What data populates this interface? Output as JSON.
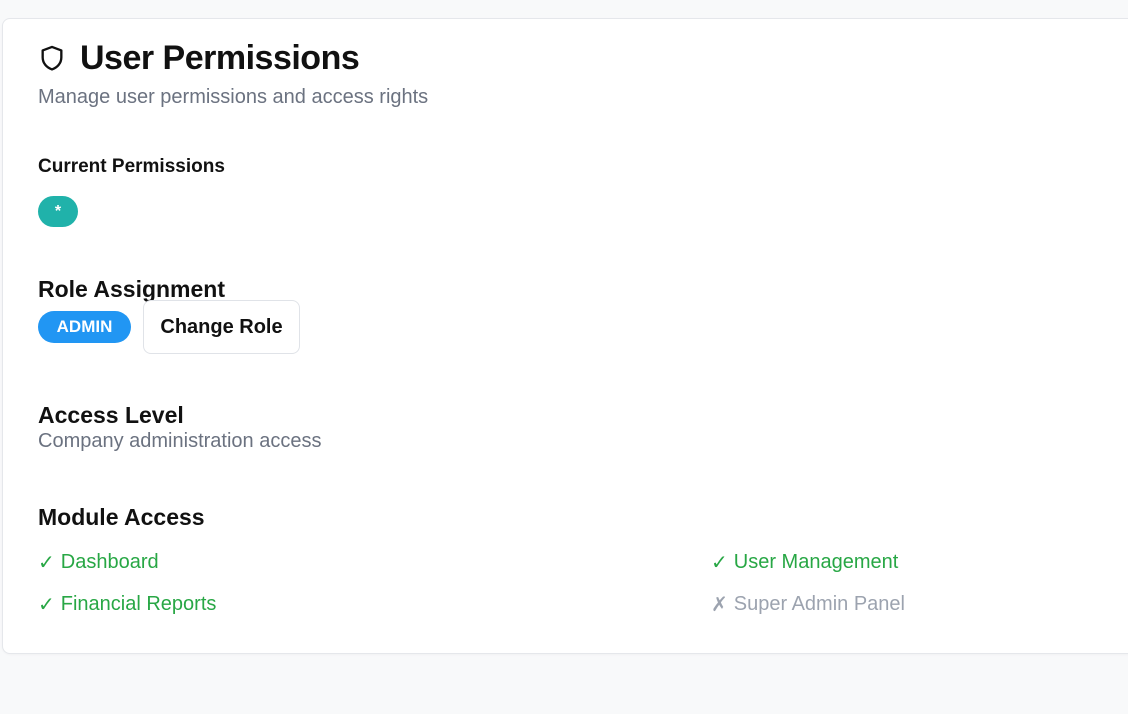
{
  "header": {
    "title": "User Permissions",
    "subtitle": "Manage user permissions and access rights",
    "icon": "shield-icon"
  },
  "current_permissions": {
    "label": "Current Permissions",
    "items": [
      "*"
    ],
    "chip_color": "#20b2aa"
  },
  "role_assignment": {
    "heading": "Role Assignment",
    "role": "ADMIN",
    "role_color": "#2196f3",
    "change_button": "Change Role"
  },
  "access_level": {
    "heading": "Access Level",
    "description": "Company administration access"
  },
  "module_access": {
    "heading": "Module Access",
    "granted_color": "#28a745",
    "denied_color": "#9ca3af",
    "modules": [
      {
        "mark": "✓",
        "name": "Dashboard",
        "granted": true
      },
      {
        "mark": "✓",
        "name": "User Management",
        "granted": true
      },
      {
        "mark": "✓",
        "name": "Financial Reports",
        "granted": true
      },
      {
        "mark": "✗",
        "name": "Super Admin Panel",
        "granted": false
      }
    ]
  }
}
